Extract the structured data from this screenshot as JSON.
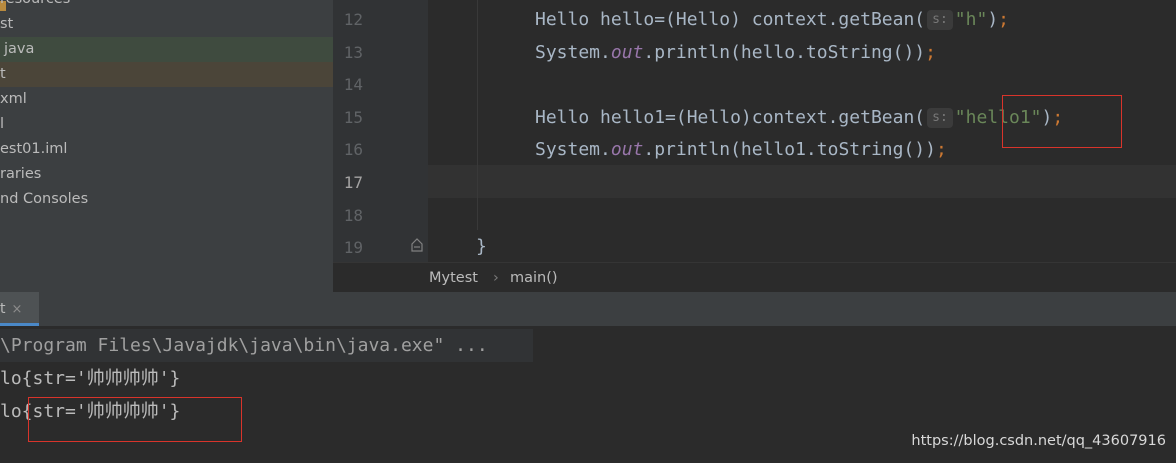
{
  "project_tree": {
    "items": [
      {
        "label": "resources",
        "state": "normal"
      },
      {
        "label": "st",
        "state": "normal"
      },
      {
        "label": "java",
        "state": "selected-green"
      },
      {
        "label": "t",
        "state": "selected-brown"
      },
      {
        "label": "xml",
        "state": "normal"
      },
      {
        "label": "l",
        "state": "normal"
      },
      {
        "label": "est01.iml",
        "state": "normal"
      },
      {
        "label": "raries",
        "state": "normal"
      },
      {
        "label": "nd Consoles",
        "state": "normal"
      }
    ]
  },
  "editor": {
    "lines": [
      {
        "number": "12",
        "parts": [
          {
            "t": "Hello hello=(Hello) context.getBean(",
            "c": "plain"
          },
          {
            "t": "s:",
            "c": "hint"
          },
          {
            "t": "\"h\"",
            "c": "str"
          },
          {
            "t": ")",
            "c": "plain"
          },
          {
            "t": ";",
            "c": "punc"
          }
        ]
      },
      {
        "number": "13",
        "parts": [
          {
            "t": "System.",
            "c": "plain"
          },
          {
            "t": "out",
            "c": "field"
          },
          {
            "t": ".println(hello.toString())",
            "c": "plain"
          },
          {
            "t": ";",
            "c": "punc"
          }
        ]
      },
      {
        "number": "14",
        "parts": []
      },
      {
        "number": "15",
        "parts": [
          {
            "t": "Hello hello1=(Hello)context.getBean(",
            "c": "plain"
          },
          {
            "t": "s:",
            "c": "hint"
          },
          {
            "t": "\"hello1\"",
            "c": "str"
          },
          {
            "t": ")",
            "c": "plain"
          },
          {
            "t": ";",
            "c": "punc"
          }
        ]
      },
      {
        "number": "16",
        "parts": [
          {
            "t": "System.",
            "c": "plain"
          },
          {
            "t": "out",
            "c": "field"
          },
          {
            "t": ".println(hello1.toString())",
            "c": "plain"
          },
          {
            "t": ";",
            "c": "punc"
          }
        ]
      },
      {
        "number": "17",
        "parts": [],
        "current": true
      },
      {
        "number": "18",
        "parts": []
      },
      {
        "number": "19",
        "parts": []
      }
    ],
    "closing_brace": "}"
  },
  "breadcrumb": {
    "class_name": "Mytest",
    "separator": "›",
    "method_name": "main()"
  },
  "run_tool": {
    "tab_label": "t",
    "close_symbol": "×"
  },
  "console": {
    "lines": [
      "\\Program Files\\Javajdk\\java\\bin\\java.exe\" ...",
      "lo{str='帅帅帅帅'}",
      "lo{str='帅帅帅帅'}"
    ]
  },
  "watermark": "https://blog.csdn.net/qq_43607916",
  "colors": {
    "accent_blue": "#4a88c7",
    "highlight_box": "#d9342b",
    "string_green": "#6a8759",
    "punctuation_orange": "#cc7832",
    "field_purple": "#9876aa"
  }
}
